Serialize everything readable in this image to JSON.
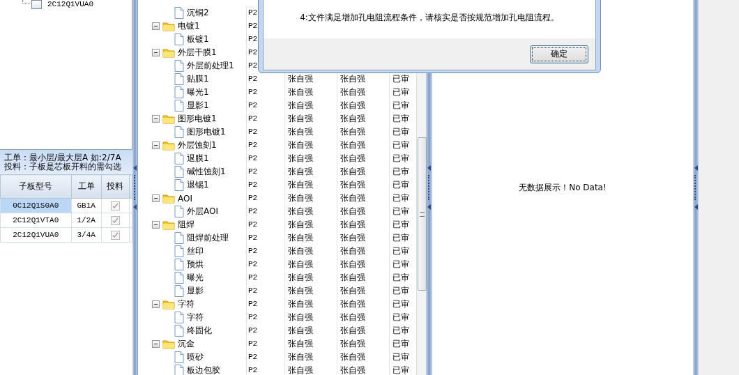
{
  "left_panel": {
    "tree_item": {
      "label": "2C12Q1VUA0"
    },
    "hint_lines": [
      "工单：最小层/最大层A 如:2/7A",
      "投料：子板是芯板开料的需勾选"
    ],
    "table": {
      "columns": [
        "子板型号",
        "工单",
        "投料"
      ],
      "rows": [
        {
          "cells": [
            "0C12Q1S0A0",
            "GB1A"
          ],
          "checked": true,
          "selected": true
        },
        {
          "cells": [
            "2C12Q1VTA0",
            "1/2A"
          ],
          "checked": true,
          "selected": false
        },
        {
          "cells": [
            "2C12Q1VUA0",
            "3/4A"
          ],
          "checked": true,
          "selected": false
        }
      ]
    }
  },
  "process_tree": [
    {
      "children": [
        {
          "label": "沉铜2",
          "cells": [
            "P2"
          ]
        }
      ]
    },
    {
      "label": "电镀1",
      "expanded": true,
      "cells": [
        "P2"
      ],
      "children": [
        {
          "label": "板镀1",
          "cells": [
            "P2"
          ]
        }
      ]
    },
    {
      "label": "外层干膜1",
      "expanded": true,
      "cells": [
        "P2"
      ],
      "children": [
        {
          "label": "外层前处理1",
          "cells": [
            "P2"
          ]
        },
        {
          "label": "贴膜1",
          "cells": [
            "P2",
            "张自强",
            "张自强",
            "已审"
          ]
        },
        {
          "label": "曝光1",
          "cells": [
            "P2",
            "张自强",
            "张自强",
            "已审"
          ]
        },
        {
          "label": "显影1",
          "cells": [
            "P2",
            "张自强",
            "张自强",
            "已审"
          ]
        }
      ]
    },
    {
      "label": "图形电镀1",
      "expanded": true,
      "cells": [
        "P2",
        "张自强",
        "张自强",
        "已审"
      ],
      "children": [
        {
          "label": "图形电镀1",
          "cells": [
            "P2",
            "张自强",
            "张自强",
            "已审"
          ]
        }
      ]
    },
    {
      "label": "外层蚀刻1",
      "expanded": true,
      "cells": [
        "P2",
        "张自强",
        "张自强",
        "已审"
      ],
      "children": [
        {
          "label": "退膜1",
          "cells": [
            "P2",
            "张自强",
            "张自强",
            "已审"
          ]
        },
        {
          "label": "碱性蚀刻1",
          "cells": [
            "P2",
            "张自强",
            "张自强",
            "已审"
          ]
        },
        {
          "label": "退锡1",
          "cells": [
            "P2",
            "张自强",
            "张自强",
            "已审"
          ]
        }
      ]
    },
    {
      "label": "AOI",
      "expanded": true,
      "cells": [
        "P2",
        "张自强",
        "张自强",
        "已审"
      ],
      "children": [
        {
          "label": "外层AOI",
          "cells": [
            "P2",
            "张自强",
            "张自强",
            "已审"
          ]
        }
      ]
    },
    {
      "label": "阻焊",
      "expanded": true,
      "cells": [
        "P2",
        "张自强",
        "张自强",
        "已审"
      ],
      "children": [
        {
          "label": "阻焊前处理",
          "cells": [
            "P2",
            "张自强",
            "张自强",
            "已审"
          ]
        },
        {
          "label": "丝印",
          "cells": [
            "P2",
            "张自强",
            "张自强",
            "已审"
          ]
        },
        {
          "label": "预烘",
          "cells": [
            "P2",
            "张自强",
            "张自强",
            "已审"
          ]
        },
        {
          "label": "曝光",
          "cells": [
            "P2",
            "张自强",
            "张自强",
            "已审"
          ]
        },
        {
          "label": "显影",
          "cells": [
            "P2",
            "张自强",
            "张自强",
            "已审"
          ]
        }
      ]
    },
    {
      "label": "字符",
      "expanded": true,
      "cells": [
        "P2",
        "张自强",
        "张自强",
        "已审"
      ],
      "children": [
        {
          "label": "字符",
          "cells": [
            "P2",
            "张自强",
            "张自强",
            "已审"
          ]
        },
        {
          "label": "终固化",
          "cells": [
            "P2",
            "张自强",
            "张自强",
            "已审"
          ]
        }
      ]
    },
    {
      "label": "沉金",
      "expanded": true,
      "cells": [
        "P2",
        "张自强",
        "张自强",
        "已审"
      ],
      "children": [
        {
          "label": "喷砂",
          "cells": [
            "P2",
            "张自强",
            "张自强",
            "已审"
          ]
        },
        {
          "label": "板边包胶",
          "cells": [
            "P2",
            "张自强",
            "张自强",
            "已审"
          ]
        }
      ]
    }
  ],
  "right_panel": {
    "empty_message": "无数据展示！No Data!"
  },
  "dialog": {
    "message": "4:文件满足增加孔电阻流程条件，请核实是否按规范增加孔电阻流程。",
    "buttons": [
      "确定"
    ]
  }
}
